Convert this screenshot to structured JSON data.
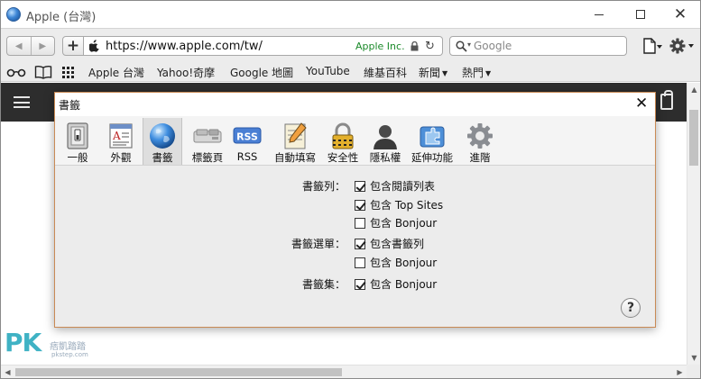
{
  "window": {
    "title": "Apple (台灣)"
  },
  "toolbar": {
    "url": "https://www.apple.com/tw/",
    "cert_name": "Apple Inc.",
    "search_placeholder": "Google"
  },
  "bookmarks": [
    {
      "label": "Apple 台灣"
    },
    {
      "label": "Yahoo!奇摩"
    },
    {
      "label": "Google 地圖"
    },
    {
      "label": "YouTube"
    },
    {
      "label": "維基百科"
    },
    {
      "label": "新聞",
      "menu": true
    },
    {
      "label": "熱門",
      "menu": true
    }
  ],
  "dialog": {
    "title": "書籤",
    "tabs": [
      {
        "label": "一般",
        "icon": "switch-icon",
        "selected": false
      },
      {
        "label": "外觀",
        "icon": "appearance-icon",
        "selected": false
      },
      {
        "label": "書籤",
        "icon": "globe-icon",
        "selected": true
      },
      {
        "label": "標籤頁",
        "icon": "tabs-icon",
        "selected": false
      },
      {
        "label": "RSS",
        "icon": "rss-icon",
        "selected": false
      },
      {
        "label": "自動填寫",
        "icon": "autofill-icon",
        "selected": false
      },
      {
        "label": "安全性",
        "icon": "lock-icon",
        "selected": false
      },
      {
        "label": "隱私權",
        "icon": "person-icon",
        "selected": false
      },
      {
        "label": "延伸功能",
        "icon": "puzzle-icon",
        "selected": false
      },
      {
        "label": "進階",
        "icon": "gear-icon",
        "selected": false
      }
    ],
    "sections": [
      {
        "label": "書籤列：",
        "options": [
          {
            "label": "包含閱讀列表",
            "checked": true
          },
          {
            "label": "包含 Top Sites",
            "checked": true
          },
          {
            "label": "包含 Bonjour",
            "checked": false
          }
        ]
      },
      {
        "label": "書籤選單：",
        "options": [
          {
            "label": "包含書籤列",
            "checked": true
          },
          {
            "label": "包含 Bonjour",
            "checked": false
          }
        ]
      },
      {
        "label": "書籤集：",
        "options": [
          {
            "label": "包含 Bonjour",
            "checked": true
          }
        ]
      }
    ],
    "help_label": "?"
  },
  "watermark": {
    "brand": "PK",
    "text": "痞凱踏踏",
    "url": "pkstep.com"
  }
}
